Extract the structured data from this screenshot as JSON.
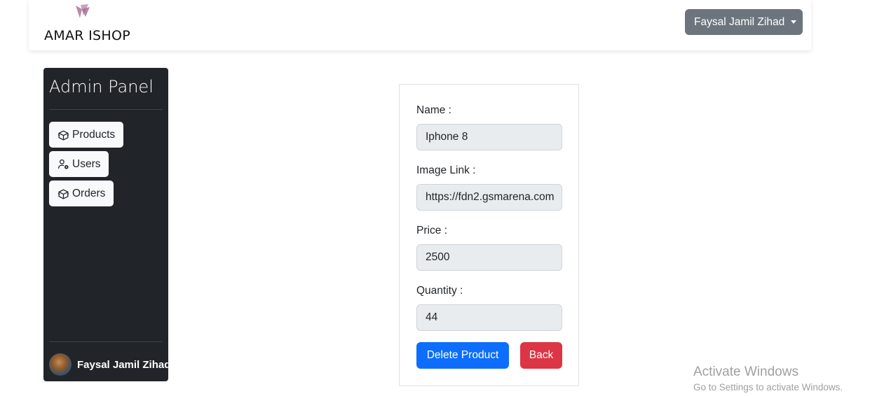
{
  "navbar": {
    "brand": "AMAR ISHOP",
    "user_menu_label": "Faysal Jamil Zihad"
  },
  "sidebar": {
    "title": "Admin Panel",
    "items": [
      {
        "label": "Products",
        "icon": "box-icon"
      },
      {
        "label": "Users",
        "icon": "user-gear-icon"
      },
      {
        "label": "Orders",
        "icon": "box-icon"
      }
    ],
    "profile_name": "Faysal Jamil Zihad"
  },
  "form": {
    "name_label": "Name :",
    "name_value": "Iphone 8",
    "image_label": "Image Link :",
    "image_value": "https://fdn2.gsmarena.com",
    "price_label": "Price :",
    "price_value": "2500",
    "quantity_label": "Quantity :",
    "quantity_value": "44",
    "delete_label": "Delete Product",
    "back_label": "Back"
  },
  "watermark": {
    "title": "Activate Windows",
    "subtitle": "Go to Settings to activate Windows."
  },
  "colors": {
    "primary": "#0d6efd",
    "danger": "#dc3545",
    "secondary": "#6c757d",
    "sidebar_bg": "#212529"
  }
}
